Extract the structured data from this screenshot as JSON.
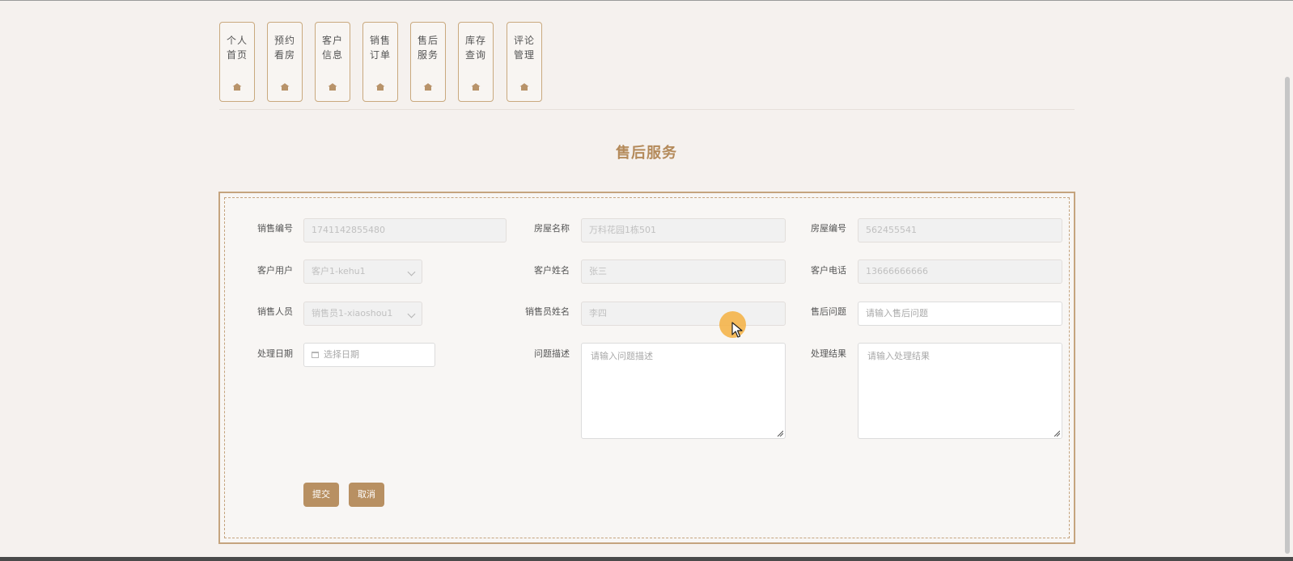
{
  "nav": {
    "items": [
      {
        "label": "个人首页",
        "icon": "home-icon"
      },
      {
        "label": "预约看房",
        "icon": "home-icon"
      },
      {
        "label": "客户信息",
        "icon": "home-icon"
      },
      {
        "label": "销售订单",
        "icon": "home-icon"
      },
      {
        "label": "售后服务",
        "icon": "home-icon"
      },
      {
        "label": "库存查询",
        "icon": "home-icon"
      },
      {
        "label": "评论管理",
        "icon": "home-icon"
      }
    ]
  },
  "page": {
    "title": "售后服务"
  },
  "form": {
    "sale_no": {
      "label": "销售编号",
      "value": "1741142855480"
    },
    "house_name": {
      "label": "房屋名称",
      "value": "万科花园1栋501"
    },
    "house_no": {
      "label": "房屋编号",
      "value": "562455541"
    },
    "customer_user": {
      "label": "客户用户",
      "value": "客户1-kehu1"
    },
    "customer_name": {
      "label": "客户姓名",
      "value": "张三"
    },
    "customer_phone": {
      "label": "客户电话",
      "value": "13666666666"
    },
    "salesperson": {
      "label": "销售人员",
      "value": "销售员1-xiaoshou1"
    },
    "salesperson_name": {
      "label": "销售员姓名",
      "value": "李四"
    },
    "after_sale_issue": {
      "label": "售后问题",
      "placeholder": "请输入售后问题"
    },
    "process_date": {
      "label": "处理日期",
      "placeholder": "选择日期"
    },
    "issue_desc": {
      "label": "问题描述",
      "placeholder": "请输入问题描述"
    },
    "process_result": {
      "label": "处理结果",
      "placeholder": "请输入处理结果"
    },
    "submit_label": "提交",
    "cancel_label": "取消"
  },
  "colors": {
    "accent": "#b89062",
    "title": "#b48a5a",
    "border": "#c5a47e",
    "background": "#f5f1ee",
    "cursor_halo": "#f5b041"
  }
}
